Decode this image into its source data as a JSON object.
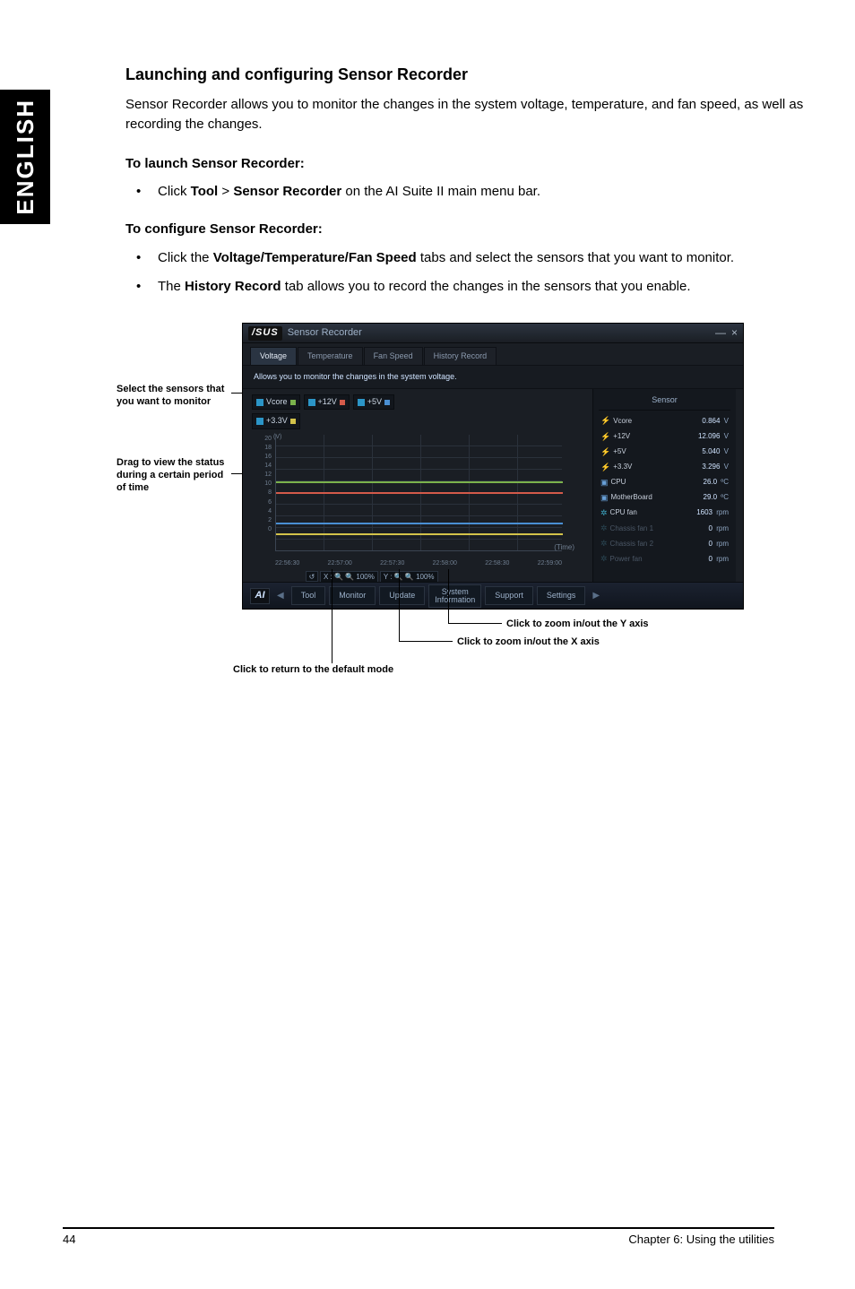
{
  "sideTab": "ENGLISH",
  "heading": "Launching and configuring Sensor Recorder",
  "intro": "Sensor Recorder allows you to monitor the changes in the system voltage, temperature, and fan speed, as well as recording the changes.",
  "launchTitle": "To launch Sensor Recorder:",
  "launchStep_pre": "Click ",
  "launchStep_b1": "Tool",
  "launchStep_mid": " > ",
  "launchStep_b2": "Sensor Recorder",
  "launchStep_post": " on the AI Suite II main menu bar.",
  "configTitle": "To configure Sensor Recorder:",
  "configStep1_pre": "Click the ",
  "configStep1_b": "Voltage/Temperature/Fan Speed",
  "configStep1_post": " tabs and select the sensors that you want to monitor.",
  "configStep2_pre": "The ",
  "configStep2_b": "History Record",
  "configStep2_post": " tab allows you to record the changes in the sensors that you enable.",
  "callouts": {
    "select": "Select the sensors that you want to monitor",
    "drag": "Drag to view the status during a certain period of time",
    "zoomY": "Click to zoom in/out the Y axis",
    "zoomX": "Click to zoom in/out the X axis",
    "reset": "Click to return to the default mode"
  },
  "app": {
    "brand": "/SUS",
    "title": "Sensor Recorder",
    "tabs": {
      "voltage": "Voltage",
      "temperature": "Temperature",
      "fan": "Fan Speed",
      "history": "History Record"
    },
    "subtitle": "Allows you to monitor the changes in the system voltage.",
    "checks": {
      "vcore": "Vcore",
      "p12v": "+12V",
      "p5v": "+5V",
      "p33v": "+3.3V"
    },
    "chart": {
      "unitLabel": "(V)",
      "y": [
        "20",
        "18",
        "16",
        "14",
        "12",
        "10",
        "8",
        "6",
        "4",
        "2",
        "0"
      ],
      "x": [
        "22:56:30",
        "22:57:00",
        "22:57:30",
        "22:58:00",
        "22:58:30",
        "22:59:00"
      ],
      "timeLabel": "(Time)"
    },
    "zoom": {
      "reset": "↺",
      "xlbl": "X :",
      "ylbl": "Y :",
      "pct": "100%"
    },
    "sensor": {
      "title": "Sensor",
      "rows": [
        {
          "icon": "bolt",
          "name": "Vcore",
          "value": "0.864",
          "unit": "V",
          "dim": false
        },
        {
          "icon": "bolt",
          "name": "+12V",
          "value": "12.096",
          "unit": "V",
          "dim": false
        },
        {
          "icon": "bolt",
          "name": "+5V",
          "value": "5.040",
          "unit": "V",
          "dim": false
        },
        {
          "icon": "bolt",
          "name": "+3.3V",
          "value": "3.296",
          "unit": "V",
          "dim": false
        },
        {
          "icon": "chip",
          "name": "CPU",
          "value": "26.0",
          "unit": "ºC",
          "dim": false
        },
        {
          "icon": "chip",
          "name": "MotherBoard",
          "value": "29.0",
          "unit": "ºC",
          "dim": false
        },
        {
          "icon": "fan",
          "name": "CPU fan",
          "value": "1603",
          "unit": "rpm",
          "dim": false
        },
        {
          "icon": "fan",
          "name": "Chassis fan 1",
          "value": "0",
          "unit": "rpm",
          "dim": true
        },
        {
          "icon": "fan",
          "name": "Chassis fan 2",
          "value": "0",
          "unit": "rpm",
          "dim": true
        },
        {
          "icon": "fan",
          "name": "Power fan",
          "value": "0",
          "unit": "rpm",
          "dim": true
        }
      ]
    },
    "bottom": {
      "ai": "AI",
      "tool": "Tool",
      "monitor": "Monitor",
      "update": "Update",
      "sysinfo": "System\nInformation",
      "support": "Support",
      "settings": "Settings"
    }
  },
  "chart_data": {
    "type": "line",
    "title": "Allows you to monitor the changes in the system voltage.",
    "xlabel": "(Time)",
    "ylabel": "(V)",
    "ylim": [
      0,
      20
    ],
    "x": [
      "22:56:30",
      "22:57:00",
      "22:57:30",
      "22:58:00",
      "22:58:30",
      "22:59:00"
    ],
    "series": [
      {
        "name": "Vcore",
        "color": "#7bb24c",
        "value_approx": 12
      },
      {
        "name": "+12V",
        "color": "#d35a4a",
        "value_approx": 10
      },
      {
        "name": "+5V",
        "color": "#4a8fd3",
        "value_approx": 5
      },
      {
        "name": "+3.3V",
        "color": "#d3c24a",
        "value_approx": 3.3
      }
    ]
  },
  "footer": {
    "page": "44",
    "chapter": "Chapter 6: Using the utilities"
  }
}
